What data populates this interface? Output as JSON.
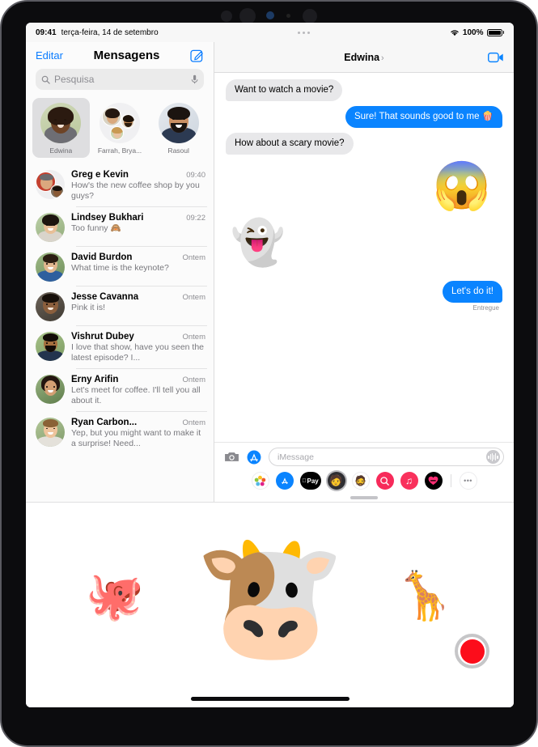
{
  "status_bar": {
    "time": "09:41",
    "date": "terça-feira, 14 de setembro",
    "battery_percent": "100%",
    "wifi_icon": "wifi-icon",
    "battery_icon": "battery-full-icon"
  },
  "sidebar": {
    "edit_label": "Editar",
    "title": "Mensagens",
    "compose_icon": "compose-icon",
    "search": {
      "placeholder": "Pesquisa",
      "search_icon": "search-icon",
      "mic_icon": "microphone-icon"
    },
    "pinned": [
      {
        "name": "Edwina",
        "selected": true
      },
      {
        "name": "Farrah, Brya...",
        "selected": false
      },
      {
        "name": "Rasoul",
        "selected": false
      }
    ],
    "conversations": [
      {
        "name": "Greg e Kevin",
        "time": "09:40",
        "preview": "How's the new coffee shop by you guys?"
      },
      {
        "name": "Lindsey Bukhari",
        "time": "09:22",
        "preview": "Too funny 🙈"
      },
      {
        "name": "David Burdon",
        "time": "Ontem",
        "preview": "What time is the keynote?"
      },
      {
        "name": "Jesse Cavanna",
        "time": "Ontem",
        "preview": "Pink it is!"
      },
      {
        "name": "Vishrut Dubey",
        "time": "Ontem",
        "preview": "I love that show, have you seen the latest episode? I..."
      },
      {
        "name": "Erny Arifin",
        "time": "Ontem",
        "preview": "Let's meet for coffee. I'll tell you all about it."
      },
      {
        "name": "Ryan Carbon...",
        "time": "Ontem",
        "preview": "Yep, but you might want to make it a surprise! Need..."
      }
    ]
  },
  "chat": {
    "title": "Edwina",
    "chevron": "›",
    "facetime_icon": "facetime-video-icon",
    "messages": [
      {
        "kind": "text",
        "side": "in",
        "text": "Want to watch a movie?"
      },
      {
        "kind": "text",
        "side": "out",
        "text": "Sure! That sounds good to me 🍿"
      },
      {
        "kind": "text",
        "side": "in",
        "text": "How about a scary movie?"
      },
      {
        "kind": "sticker",
        "side": "out",
        "glyph": "😱",
        "name": "memoji-shocked-sticker"
      },
      {
        "kind": "sticker",
        "side": "in",
        "glyph": "👻",
        "name": "ghost-sticker"
      },
      {
        "kind": "text",
        "side": "out",
        "text": "Let's do it!"
      }
    ],
    "delivery_status": "Entregue",
    "input": {
      "placeholder": "iMessage",
      "value": "",
      "camera_icon": "camera-icon",
      "appstore_icon": "app-store-icon",
      "audio_icon": "audio-waveform-icon"
    },
    "app_drawer": [
      {
        "name": "photos-app-icon",
        "glyph": "",
        "selected": false
      },
      {
        "name": "app-store-app-icon",
        "glyph": "",
        "selected": false
      },
      {
        "name": "apple-pay-app-icon",
        "glyph": "Pay",
        "selected": false
      },
      {
        "name": "memoji-app-icon",
        "glyph": "🧑",
        "selected": true
      },
      {
        "name": "animoji-stickers-icon",
        "glyph": "🧔",
        "selected": false
      },
      {
        "name": "images-search-app-icon",
        "glyph": "",
        "selected": false
      },
      {
        "name": "music-app-icon",
        "glyph": "♫",
        "selected": false
      },
      {
        "name": "digital-touch-app-icon",
        "glyph": "",
        "selected": false
      },
      {
        "name": "more-apps-icon",
        "glyph": "•••",
        "selected": false
      }
    ]
  },
  "memoji_picker": {
    "items": [
      {
        "name": "octopus-animoji",
        "glyph": "🐙",
        "size": "small"
      },
      {
        "name": "cow-animoji",
        "glyph": "🐮",
        "size": "big"
      },
      {
        "name": "giraffe-animoji",
        "glyph": "🦒",
        "size": "small"
      }
    ],
    "record_button": "record-button"
  },
  "colors": {
    "accent_blue": "#0a84ff",
    "bubble_gray": "#e8e8ea",
    "record_red": "#fc0d1b",
    "link_blue": "#0a7cff"
  }
}
